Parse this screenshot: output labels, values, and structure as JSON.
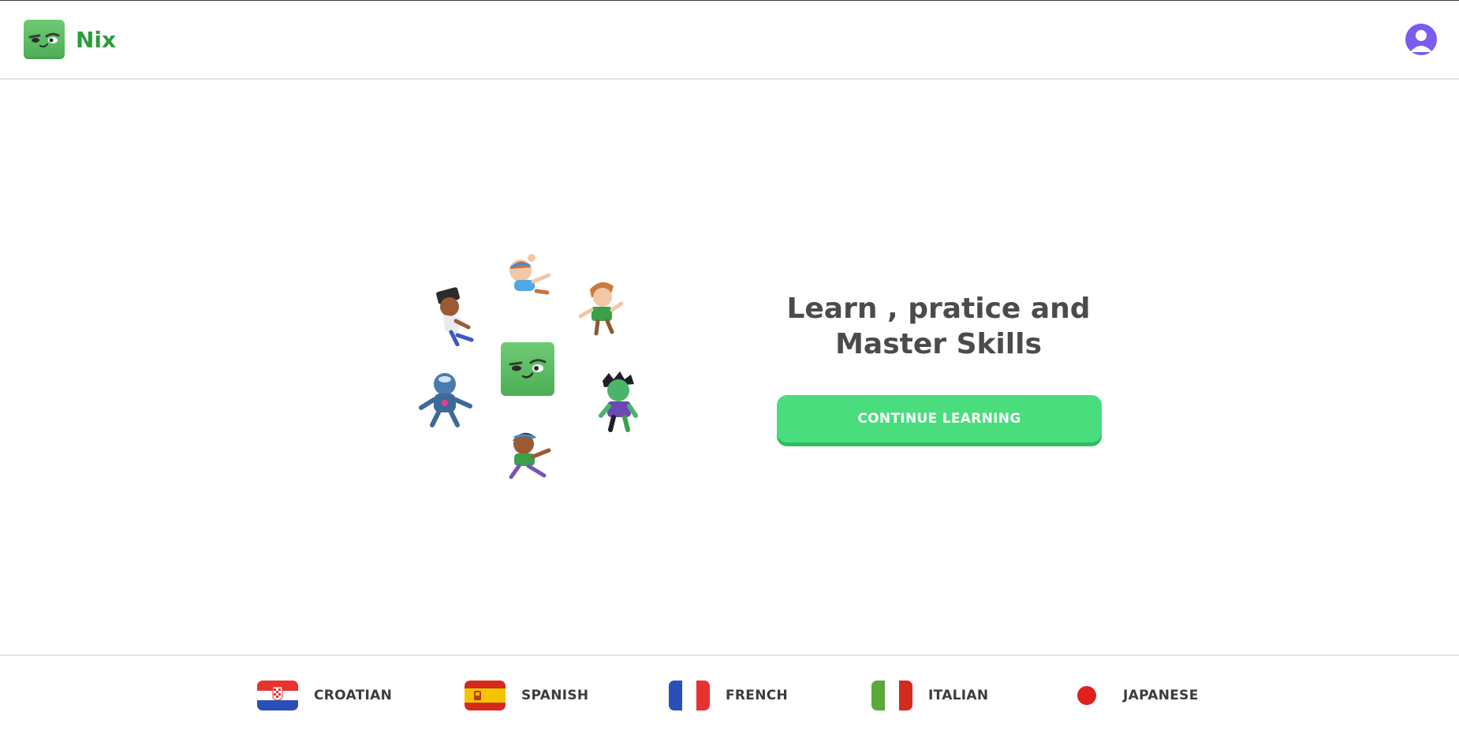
{
  "header": {
    "brand_name": "Nix",
    "logo_icon": "nix-face-icon",
    "avatar_icon": "user-avatar-icon",
    "brand_color": "#2e9c3a",
    "avatar_color": "#7a5cf0"
  },
  "hero": {
    "title": "Learn , pratice and Master Skills",
    "cta_label": "CONTINUE LEARNING",
    "cta_color": "#49dd7d",
    "characters": [
      "girl-character",
      "boy-character",
      "zombie-character",
      "kid-character",
      "robot-character",
      "dancer-character"
    ]
  },
  "languages": [
    {
      "label": "CROATIAN",
      "flag": "croatia-flag-icon"
    },
    {
      "label": "SPANISH",
      "flag": "spain-flag-icon"
    },
    {
      "label": "FRENCH",
      "flag": "france-flag-icon"
    },
    {
      "label": "ITALIAN",
      "flag": "italy-flag-icon"
    },
    {
      "label": "JAPANESE",
      "flag": "japan-flag-icon"
    }
  ]
}
